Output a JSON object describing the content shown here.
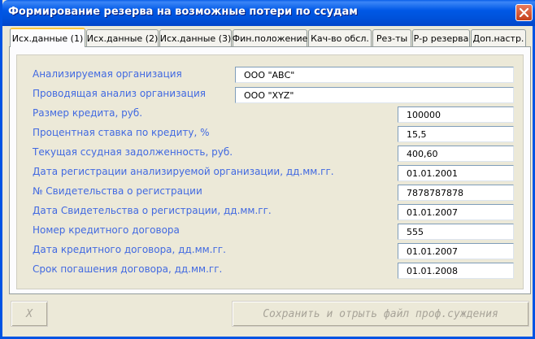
{
  "window": {
    "title": "Формирование резерва на возможные потери по ссудам"
  },
  "tabs": [
    {
      "label": "Исх.данные (1)",
      "active": true
    },
    {
      "label": "Исх.данные (2)",
      "active": false
    },
    {
      "label": "Исх.данные (3)",
      "active": false
    },
    {
      "label": "Фин.положение",
      "active": false
    },
    {
      "label": "Кач-во обсл.",
      "active": false
    },
    {
      "label": "Рез-ты",
      "active": false
    },
    {
      "label": "Р-р резерва",
      "active": false
    },
    {
      "label": "Доп.настр.",
      "active": false
    }
  ],
  "form": {
    "fields": [
      {
        "label": "Анализируемая оргaнизация",
        "value": "ООО \"АВС\""
      },
      {
        "label": "Проводящая анализ организация",
        "value": "ООО \"XYZ\""
      },
      {
        "label": "Размер кредита, руб.",
        "value": "100000"
      },
      {
        "label": "Процентная ставка по кредиту, %",
        "value": "15,5"
      },
      {
        "label": "Текущая ссудная задолженность, руб.",
        "value": "400,60"
      },
      {
        "label": "Дата регистрации анализируемой организации, дд.мм.гг.",
        "value": "01.01.2001"
      },
      {
        "label": "№ Свидетельства о регистрации",
        "value": "7878787878"
      },
      {
        "label": "Дата Свидетельства о регистрации, дд.мм.гг.",
        "value": "01.01.2007"
      },
      {
        "label": "Номер кредитного договора",
        "value": "555"
      },
      {
        "label": "Дата кредитного договора, дд.мм.гг.",
        "value": "01.01.2007"
      },
      {
        "label": "Срок погашения договора, дд.мм.гг.",
        "value": "01.01.2008"
      }
    ]
  },
  "buttons": {
    "close_label": "X",
    "save_label": "Сохранить и отрыть файл проф.суждения"
  },
  "colors": {
    "label_text": "#4169E1",
    "titlebar": "#0058E6",
    "active_tab_highlight": "#FFC83C"
  }
}
